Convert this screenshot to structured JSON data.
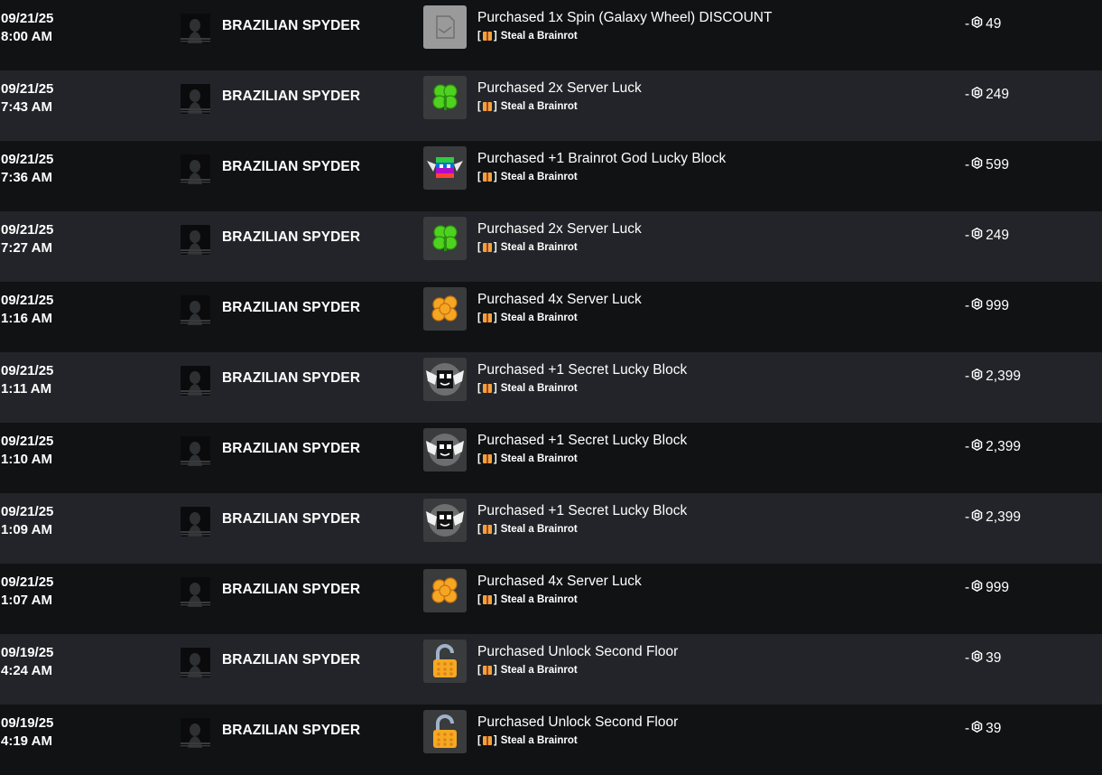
{
  "transactions": [
    {
      "date": "09/21/25",
      "time": "8:00 AM",
      "user": "BRAZILIAN SPYDER",
      "item": "Purchased 1x Spin (Galaxy Wheel) DISCOUNT",
      "icon": "placeholder-item-icon",
      "experience": "Steal a Brainrot",
      "amount": "49"
    },
    {
      "date": "09/21/25",
      "time": "7:43 AM",
      "user": "BRAZILIAN SPYDER",
      "item": "Purchased 2x Server Luck",
      "icon": "green-clover-icon",
      "experience": "Steal a Brainrot",
      "amount": "249"
    },
    {
      "date": "09/21/25",
      "time": "7:36 AM",
      "user": "BRAZILIAN SPYDER",
      "item": "Purchased +1 Brainrot God Lucky Block",
      "icon": "rainbow-winged-block-icon",
      "experience": "Steal a Brainrot",
      "amount": "599"
    },
    {
      "date": "09/21/25",
      "time": "7:27 AM",
      "user": "BRAZILIAN SPYDER",
      "item": "Purchased 2x Server Luck",
      "icon": "green-clover-icon",
      "experience": "Steal a Brainrot",
      "amount": "249"
    },
    {
      "date": "09/21/25",
      "time": "1:16 AM",
      "user": "BRAZILIAN SPYDER",
      "item": "Purchased 4x Server Luck",
      "icon": "gold-clover-icon",
      "experience": "Steal a Brainrot",
      "amount": "999"
    },
    {
      "date": "09/21/25",
      "time": "1:11 AM",
      "user": "BRAZILIAN SPYDER",
      "item": "Purchased +1 Secret Lucky Block",
      "icon": "white-winged-block-icon",
      "experience": "Steal a Brainrot",
      "amount": "2,399"
    },
    {
      "date": "09/21/25",
      "time": "1:10 AM",
      "user": "BRAZILIAN SPYDER",
      "item": "Purchased +1 Secret Lucky Block",
      "icon": "white-winged-block-icon",
      "experience": "Steal a Brainrot",
      "amount": "2,399"
    },
    {
      "date": "09/21/25",
      "time": "1:09 AM",
      "user": "BRAZILIAN SPYDER",
      "item": "Purchased +1 Secret Lucky Block",
      "icon": "white-winged-block-icon",
      "experience": "Steal a Brainrot",
      "amount": "2,399"
    },
    {
      "date": "09/21/25",
      "time": "1:07 AM",
      "user": "BRAZILIAN SPYDER",
      "item": "Purchased 4x Server Luck",
      "icon": "gold-clover-icon",
      "experience": "Steal a Brainrot",
      "amount": "999"
    },
    {
      "date": "09/19/25",
      "time": "4:24 AM",
      "user": "BRAZILIAN SPYDER",
      "item": "Purchased Unlock Second Floor",
      "icon": "unlock-padlock-icon",
      "experience": "Steal a Brainrot",
      "amount": "39"
    },
    {
      "date": "09/19/25",
      "time": "4:19 AM",
      "user": "BRAZILIAN SPYDER",
      "item": "Purchased Unlock Second Floor",
      "icon": "unlock-padlock-icon",
      "experience": "Steal a Brainrot",
      "amount": "39"
    }
  ],
  "labels": {
    "amount_prefix": "-",
    "sub_bracket_open": "[",
    "sub_bracket_close": "]"
  },
  "colors": {
    "row_dark": "#111214",
    "row_light": "#232429",
    "text": "#ffffff"
  }
}
